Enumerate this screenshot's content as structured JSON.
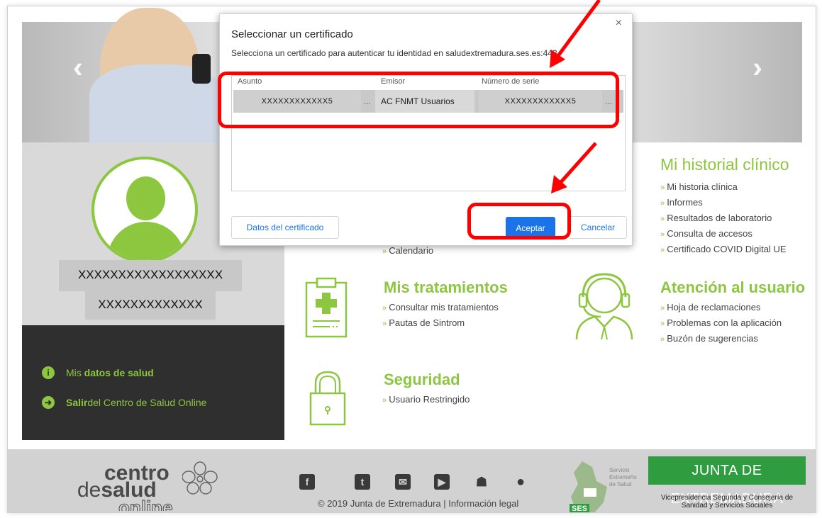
{
  "banner": {
    "prev_arrow": "‹",
    "next_arrow": "›"
  },
  "user": {
    "name_line1": "XXXXXXXXXXXXXXXXXX",
    "name_line2": "XXXXXXXXXXXXX"
  },
  "left_links": [
    {
      "icon": "info-icon",
      "prefix": "Mis ",
      "bold": "datos de salud",
      "suffix": ""
    },
    {
      "icon": "exit-icon",
      "prefix": "",
      "bold": "Salir",
      "suffix": " del Centro de Salud Online"
    }
  ],
  "historial": {
    "title": "Mi historial clínico",
    "items": [
      "Mi historia clínica",
      "Informes",
      "Resultados de laboratorio",
      "Consulta de accesos",
      "Certificado COVID Digital UE"
    ]
  },
  "calendar_partial": {
    "items": [
      "Calendario"
    ]
  },
  "tratamientos": {
    "title": "Mis tratamientos",
    "items": [
      "Consultar mis tratamientos",
      "Pautas de Sintrom"
    ]
  },
  "atencion": {
    "title": "Atención al usuario",
    "items": [
      "Hoja de reclamaciones",
      "Problemas con la aplicación",
      "Buzón de sugerencias"
    ]
  },
  "seguridad": {
    "title": "Seguridad",
    "items": [
      "Usuario Restringido"
    ]
  },
  "footer": {
    "copyright": "© 2019 Junta de Extremadura | Información legal",
    "logo_line1": "centro",
    "logo_line2": "de",
    "logo_line2_bold": "salud",
    "logo_line3": "online",
    "social": [
      "facebook-icon",
      "twitter-icon",
      "email-icon",
      "youtube-icon",
      "android-icon",
      "apple-icon"
    ],
    "ses_label": "SES",
    "ses_text": "Servicio Extremeño de Salud",
    "junta": "JUNTA DE EXTREMADURA",
    "junta_sub": "Vicepresidencia Segunda y Consejería de Sanidad y Servicios Sociales"
  },
  "dialog": {
    "title": "Seleccionar un certificado",
    "subtitle": "Selecciona un certificado para autenticar tu identidad en saludextremadura.ses.es:443.",
    "close": "×",
    "columns": [
      "Asunto",
      "Emisor",
      "Número de serie"
    ],
    "row": {
      "asunto": "XXXXXXXXXXXX5",
      "emisor": "AC FNMT Usuarios",
      "serie": "XXXXXXXXXXXX5",
      "ellipsis": "..."
    },
    "btn_datos": "Datos del certificado",
    "btn_aceptar": "Aceptar",
    "btn_cancelar": "Cancelar"
  },
  "colors": {
    "accent_green": "#8dc63f",
    "annotation_red": "#ff0000",
    "primary_blue": "#1a73e8",
    "junta_green": "#2e9c3f"
  }
}
